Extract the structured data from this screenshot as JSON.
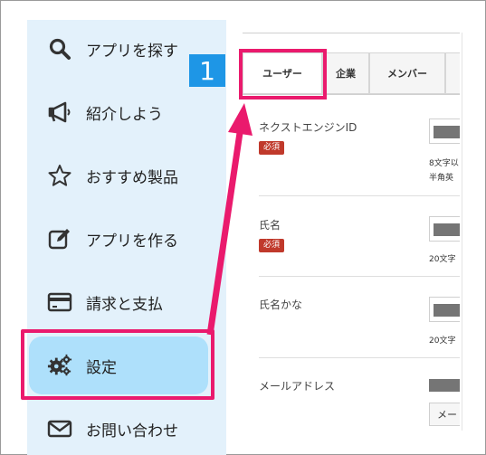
{
  "sidebar": {
    "items": [
      {
        "label": "アプリを探す",
        "icon": "search-icon"
      },
      {
        "label": "紹介しよう",
        "icon": "megaphone-icon"
      },
      {
        "label": "おすすめ製品",
        "icon": "star-icon"
      },
      {
        "label": "アプリを作る",
        "icon": "edit-icon"
      },
      {
        "label": "請求と支払",
        "icon": "credit-card-icon"
      },
      {
        "label": "設定",
        "icon": "gears-icon",
        "active": true
      },
      {
        "label": "お問い合わせ",
        "icon": "mail-icon"
      }
    ]
  },
  "annotation": {
    "step_number": "1",
    "accent_color": "#ea1a6d",
    "badge_color": "#1e96e6"
  },
  "tabs": [
    {
      "label": "ユーザー",
      "active": true
    },
    {
      "label": "企業"
    },
    {
      "label": "メンバー"
    }
  ],
  "form": {
    "fields": [
      {
        "label": "ネクストエンジンID",
        "required": "必須",
        "hint1": "8文字以",
        "hint2": "半角英"
      },
      {
        "label": "氏名",
        "required": "必須",
        "hint1": "20文字"
      },
      {
        "label": "氏名かな",
        "hint1": "20文字"
      },
      {
        "label": "メールアドレス",
        "button": "メー"
      }
    ]
  },
  "colors": {
    "sidebar_bg": "#e3f1fb",
    "active_bg": "#aee0fb",
    "required_badge": "#c0392b"
  }
}
